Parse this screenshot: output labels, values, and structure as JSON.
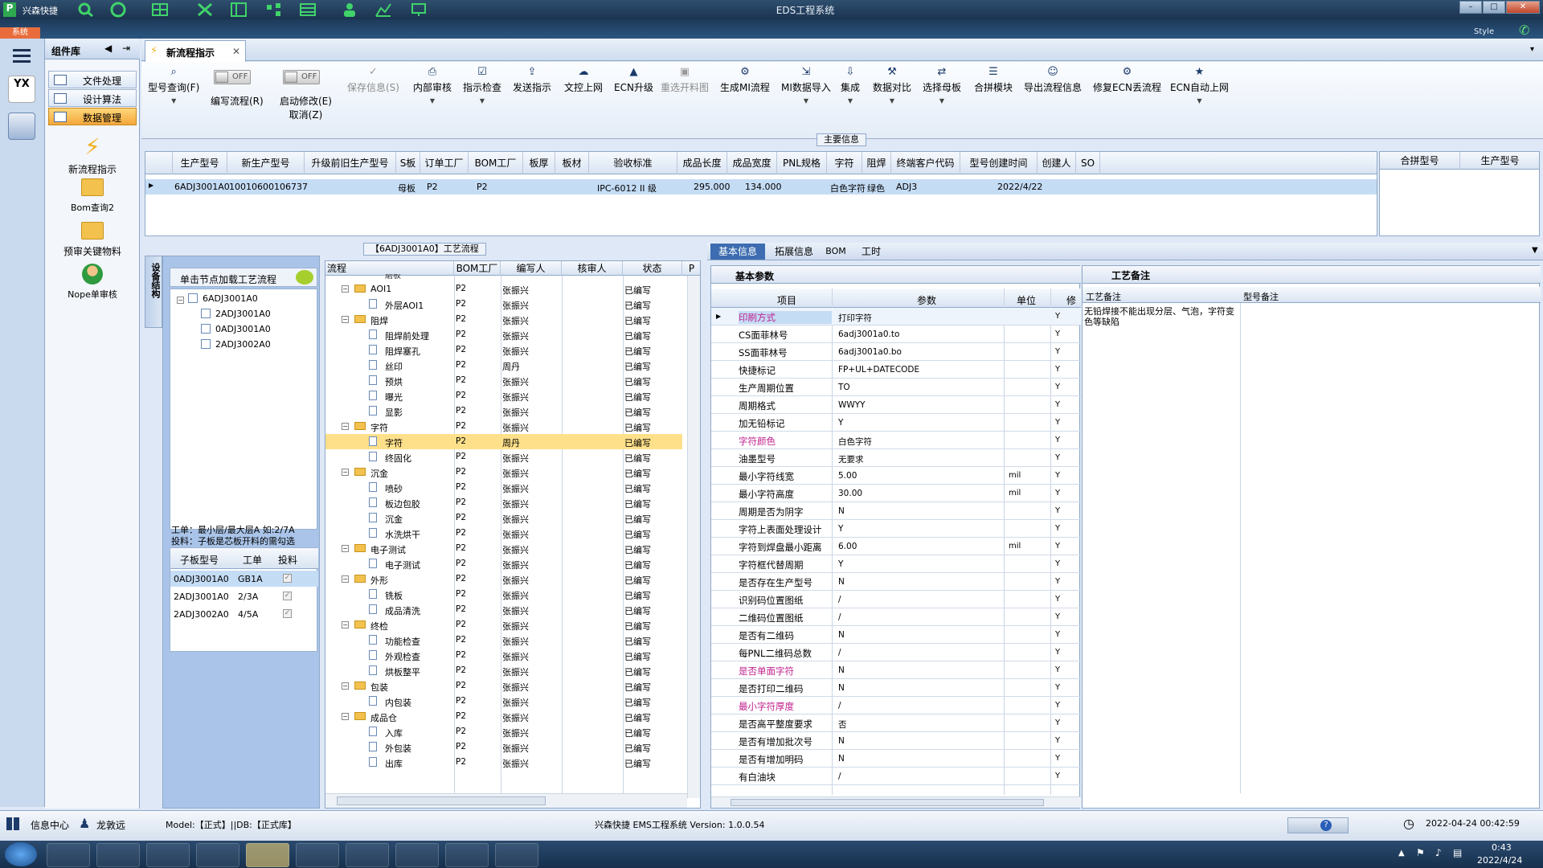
{
  "window": {
    "app_brand": "兴森快捷",
    "title": "EDS工程系统",
    "style_label": "Style",
    "system_tab": "系统"
  },
  "component_panel": {
    "title": "组件库",
    "nav": [
      {
        "label": "文件处理"
      },
      {
        "label": "设计算法"
      },
      {
        "label": "数据管理"
      }
    ],
    "big_items": [
      {
        "label": "新流程指示"
      },
      {
        "label": "Bom查询2"
      },
      {
        "label": "预审关键物料"
      },
      {
        "label": "Nope单审核"
      }
    ]
  },
  "tab": {
    "label": "新流程指示"
  },
  "toolbar": {
    "buttons": [
      {
        "label": "型号查询(F)",
        "icon": "search-icon"
      },
      {
        "label": "编写流程(R)",
        "icon": "toggle"
      },
      {
        "label": "启动修改(E)",
        "sub": "取消(Z)",
        "icon": "toggle"
      },
      {
        "label": "保存信息(S)",
        "icon": "check-icon"
      },
      {
        "label": "内部审核",
        "icon": "printer-icon"
      },
      {
        "label": "指示检查",
        "icon": "clipboard-check-icon"
      },
      {
        "label": "发送指示",
        "icon": "upload-icon"
      },
      {
        "label": "文控上网",
        "icon": "cloud-upload-icon"
      },
      {
        "label": "ECN升级",
        "icon": "eagle-icon"
      },
      {
        "label": "重选开料图",
        "icon": "image-icon"
      },
      {
        "label": "生成MI流程",
        "icon": "network-icon"
      },
      {
        "label": "MI数据导入",
        "icon": "import-icon"
      },
      {
        "label": "集成",
        "icon": "download-icon"
      },
      {
        "label": "数据对比",
        "icon": "wand-icon"
      },
      {
        "label": "选择母板",
        "icon": "shuffle-icon"
      },
      {
        "label": "合拼模块",
        "icon": "list-icon"
      },
      {
        "label": "导出流程信息",
        "icon": "smile-icon"
      },
      {
        "label": "修复ECN丢流程",
        "icon": "wrench-icon"
      },
      {
        "label": "ECN自动上网",
        "icon": "star-icon"
      }
    ],
    "toggle_off": "OFF"
  },
  "main_info": {
    "title": "主要信息",
    "columns": [
      "生产型号",
      "新生产型号",
      "升级前旧生产型号",
      "S板",
      "订单工厂",
      "BOM工厂",
      "板厚",
      "板材",
      "验收标准",
      "成品长度",
      "成品宽度",
      "PNL规格",
      "字符",
      "阻焊",
      "终端客户代码",
      "型号创建时间",
      "创建人",
      "SO"
    ],
    "rows": [
      [
        "6ADJ3001A0",
        "10010600106737",
        "",
        "母板",
        "P2",
        "P2",
        "",
        "",
        "IPC-6012 II 级",
        "295.000",
        "134.000",
        "",
        "白色字符",
        "绿色",
        "ADJ3",
        "2022/4/22",
        "",
        ""
      ]
    ],
    "side_columns": [
      "合拼型号",
      "生产型号"
    ]
  },
  "flow_panel": {
    "title": "【6ADJ3001A0】工艺流程",
    "side_tab": "设备结构",
    "hint": "单击节点加载工艺流程",
    "tree": [
      {
        "label": "6ADJ3001A0",
        "children": [
          "2ADJ3001A0",
          "0ADJ3001A0",
          "2ADJ3002A0"
        ]
      }
    ],
    "note_line1": "工单：最小层/最大层A 如:2/7A",
    "note_line2": "投料：子板是芯板开料的需勾选",
    "sub_columns": [
      "子板型号",
      "工单",
      "投料"
    ],
    "sub_rows": [
      {
        "model": "0ADJ3001A0",
        "order": "GB1A"
      },
      {
        "model": "2ADJ3001A0",
        "order": "2/3A"
      },
      {
        "model": "2ADJ3002A0",
        "order": "4/5A"
      }
    ]
  },
  "flow_table": {
    "columns": [
      "流程",
      "BOM工厂",
      "编写人",
      "核审人",
      "状态",
      "P"
    ],
    "top_partial": "磨板",
    "rows": [
      {
        "level": 0,
        "type": "folder",
        "name": "AOI1",
        "factory": "P2",
        "writer": "张振兴",
        "status": "已编写"
      },
      {
        "level": 1,
        "type": "doc",
        "name": "外层AOI1",
        "factory": "P2",
        "writer": "张振兴",
        "status": "已编写"
      },
      {
        "level": 0,
        "type": "folder",
        "name": "阻焊",
        "factory": "P2",
        "writer": "张振兴",
        "status": "已编写"
      },
      {
        "level": 1,
        "type": "doc",
        "name": "阻焊前处理",
        "factory": "P2",
        "writer": "张振兴",
        "status": "已编写"
      },
      {
        "level": 1,
        "type": "doc",
        "name": "阻焊塞孔",
        "factory": "P2",
        "writer": "张振兴",
        "status": "已编写"
      },
      {
        "level": 1,
        "type": "doc",
        "name": "丝印",
        "factory": "P2",
        "writer": "周丹",
        "status": "已编写"
      },
      {
        "level": 1,
        "type": "doc",
        "name": "预烘",
        "factory": "P2",
        "writer": "张振兴",
        "status": "已编写"
      },
      {
        "level": 1,
        "type": "doc",
        "name": "曝光",
        "factory": "P2",
        "writer": "张振兴",
        "status": "已编写"
      },
      {
        "level": 1,
        "type": "doc",
        "name": "显影",
        "factory": "P2",
        "writer": "张振兴",
        "status": "已编写"
      },
      {
        "level": 0,
        "type": "folder",
        "name": "字符",
        "factory": "P2",
        "writer": "张振兴",
        "status": "已编写"
      },
      {
        "level": 1,
        "type": "doc",
        "name": "字符",
        "factory": "P2",
        "writer": "周丹",
        "status": "已编写",
        "selected": true
      },
      {
        "level": 1,
        "type": "doc",
        "name": "终固化",
        "factory": "P2",
        "writer": "张振兴",
        "status": "已编写"
      },
      {
        "level": 0,
        "type": "folder",
        "name": "沉金",
        "factory": "P2",
        "writer": "张振兴",
        "status": "已编写"
      },
      {
        "level": 1,
        "type": "doc",
        "name": "喷砂",
        "factory": "P2",
        "writer": "张振兴",
        "status": "已编写"
      },
      {
        "level": 1,
        "type": "doc",
        "name": "板边包胶",
        "factory": "P2",
        "writer": "张振兴",
        "status": "已编写"
      },
      {
        "level": 1,
        "type": "doc",
        "name": "沉金",
        "factory": "P2",
        "writer": "张振兴",
        "status": "已编写"
      },
      {
        "level": 1,
        "type": "doc",
        "name": "水洗烘干",
        "factory": "P2",
        "writer": "张振兴",
        "status": "已编写"
      },
      {
        "level": 0,
        "type": "folder",
        "name": "电子测试",
        "factory": "P2",
        "writer": "张振兴",
        "status": "已编写"
      },
      {
        "level": 1,
        "type": "doc",
        "name": "电子测试",
        "factory": "P2",
        "writer": "张振兴",
        "status": "已编写"
      },
      {
        "level": 0,
        "type": "folder",
        "name": "外形",
        "factory": "P2",
        "writer": "张振兴",
        "status": "已编写"
      },
      {
        "level": 1,
        "type": "doc",
        "name": "铣板",
        "factory": "P2",
        "writer": "张振兴",
        "status": "已编写"
      },
      {
        "level": 1,
        "type": "doc",
        "name": "成品清洗",
        "factory": "P2",
        "writer": "张振兴",
        "status": "已编写"
      },
      {
        "level": 0,
        "type": "folder",
        "name": "终检",
        "factory": "P2",
        "writer": "张振兴",
        "status": "已编写"
      },
      {
        "level": 1,
        "type": "doc",
        "name": "功能检查",
        "factory": "P2",
        "writer": "张振兴",
        "status": "已编写"
      },
      {
        "level": 1,
        "type": "doc",
        "name": "外观检查",
        "factory": "P2",
        "writer": "张振兴",
        "status": "已编写"
      },
      {
        "level": 1,
        "type": "doc",
        "name": "烘板整平",
        "factory": "P2",
        "writer": "张振兴",
        "status": "已编写"
      },
      {
        "level": 0,
        "type": "folder",
        "name": "包装",
        "factory": "P2",
        "writer": "张振兴",
        "status": "已编写"
      },
      {
        "level": 1,
        "type": "doc",
        "name": "内包装",
        "factory": "P2",
        "writer": "张振兴",
        "status": "已编写"
      },
      {
        "level": 0,
        "type": "folder",
        "name": "成品仓",
        "factory": "P2",
        "writer": "张振兴",
        "status": "已编写"
      },
      {
        "level": 1,
        "type": "doc",
        "name": "入库",
        "factory": "P2",
        "writer": "张振兴",
        "status": "已编写"
      },
      {
        "level": 1,
        "type": "doc",
        "name": "外包装",
        "factory": "P2",
        "writer": "张振兴",
        "status": "已编写"
      },
      {
        "level": 1,
        "type": "doc",
        "name": "出库",
        "factory": "P2",
        "writer": "张振兴",
        "status": "已编写"
      }
    ]
  },
  "detail_tabs": [
    "基本信息",
    "拓展信息",
    "BOM",
    "工时"
  ],
  "basic_params": {
    "title": "基本参数",
    "columns": [
      "项目",
      "参数",
      "单位",
      "修"
    ],
    "rows": [
      {
        "item": "印刷方式",
        "value": "打印字符",
        "unit": "",
        "flag": "Y",
        "highlight": true
      },
      {
        "item": "CS面菲林号",
        "value": "6adj3001a0.to",
        "unit": "",
        "flag": "Y"
      },
      {
        "item": "SS面菲林号",
        "value": "6adj3001a0.bo",
        "unit": "",
        "flag": "Y"
      },
      {
        "item": "快捷标记",
        "value": "FP+UL+DATECODE",
        "unit": "",
        "flag": "Y"
      },
      {
        "item": "生产周期位置",
        "value": "TO",
        "unit": "",
        "flag": "Y"
      },
      {
        "item": "周期格式",
        "value": "WWYY",
        "unit": "",
        "flag": "Y"
      },
      {
        "item": "加无铅标记",
        "value": "Y",
        "unit": "",
        "flag": "Y"
      },
      {
        "item": "字符颜色",
        "value": "白色字符",
        "unit": "",
        "flag": "Y",
        "highlight": true
      },
      {
        "item": "油墨型号",
        "value": "无要求",
        "unit": "",
        "flag": "Y"
      },
      {
        "item": "最小字符线宽",
        "value": "5.00",
        "unit": "mil",
        "flag": "Y"
      },
      {
        "item": "最小字符高度",
        "value": "30.00",
        "unit": "mil",
        "flag": "Y"
      },
      {
        "item": "周期是否为阴字",
        "value": "N",
        "unit": "",
        "flag": "Y"
      },
      {
        "item": "字符上表面处理设计",
        "value": "Y",
        "unit": "",
        "flag": "Y"
      },
      {
        "item": "字符到焊盘最小距离",
        "value": "6.00",
        "unit": "mil",
        "flag": "Y"
      },
      {
        "item": "字符框代替周期",
        "value": "Y",
        "unit": "",
        "flag": "Y"
      },
      {
        "item": "是否存在生产型号",
        "value": "N",
        "unit": "",
        "flag": "Y"
      },
      {
        "item": "识别码位置图纸",
        "value": "/",
        "unit": "",
        "flag": "Y"
      },
      {
        "item": "二维码位置图纸",
        "value": "/",
        "unit": "",
        "flag": "Y"
      },
      {
        "item": "是否有二维码",
        "value": "N",
        "unit": "",
        "flag": "Y"
      },
      {
        "item": "每PNL二维码总数",
        "value": "/",
        "unit": "",
        "flag": "Y"
      },
      {
        "item": "是否单面字符",
        "value": "N",
        "unit": "",
        "flag": "Y",
        "highlight": true
      },
      {
        "item": "是否打印二维码",
        "value": "N",
        "unit": "",
        "flag": "Y"
      },
      {
        "item": "最小字符厚度",
        "value": "/",
        "unit": "",
        "flag": "Y",
        "highlight": true
      },
      {
        "item": "是否高平整度要求",
        "value": "否",
        "unit": "",
        "flag": "Y"
      },
      {
        "item": "是否有增加批次号",
        "value": "N",
        "unit": "",
        "flag": "Y"
      },
      {
        "item": "是否有增加明码",
        "value": "N",
        "unit": "",
        "flag": "Y"
      },
      {
        "item": "有白油块",
        "value": "/",
        "unit": "",
        "flag": "Y"
      }
    ]
  },
  "process_notes": {
    "title": "工艺备注",
    "columns": [
      "工艺备注",
      "型号备注"
    ],
    "process_note": "无铅焊接不能出现分层、气泡，字符变色等缺陷",
    "model_note": ""
  },
  "status_bar": {
    "info_center": "信息中心",
    "user": "龙敦远",
    "model_db": "Model:【正式】||DB:【正式库】",
    "version": "兴森快捷 EMS工程系统 Version: 1.0.0.54",
    "datetime": "2022-04-24 00:42:59"
  },
  "taskbar": {
    "time": "0:43",
    "date": "2022/4/24"
  },
  "colors": {
    "accent": "#f3a73b",
    "pink_label": "#c0208c",
    "selection": "#ffe08a",
    "header_blue": "#d9e4f2"
  }
}
